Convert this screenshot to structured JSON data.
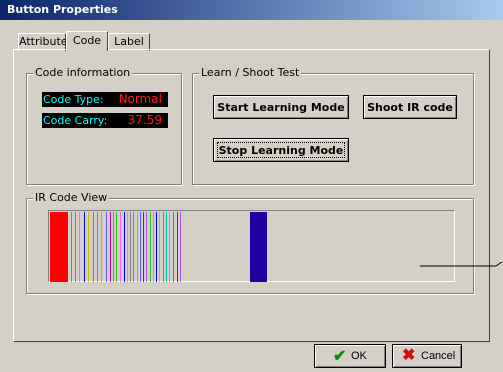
{
  "window": {
    "title": "Button Properties"
  },
  "tabs": [
    {
      "label": "Attribute"
    },
    {
      "label": "Code"
    },
    {
      "label": "Label"
    }
  ],
  "code_info": {
    "group_label": "Code information",
    "type_label": "Code Type:",
    "type_value": "Normal",
    "carry_label": "Code Carry:",
    "carry_value": "37.59"
  },
  "learn": {
    "group_label": "Learn / Shoot Test",
    "start_label": "Start Learning  Mode",
    "shoot_label": "Shoot IR code",
    "stop_label": "Stop Learning Mode"
  },
  "ir_view": {
    "group_label": "IR Code View"
  },
  "footer": {
    "ok_label": "OK",
    "cancel_label": "Cancel"
  },
  "colors": {
    "display_bg": "#000000",
    "display_label": "#00ffff",
    "display_value": "#ff1a1a",
    "ir_start_marker": "#ff0000",
    "ir_block": "#2000a0"
  }
}
